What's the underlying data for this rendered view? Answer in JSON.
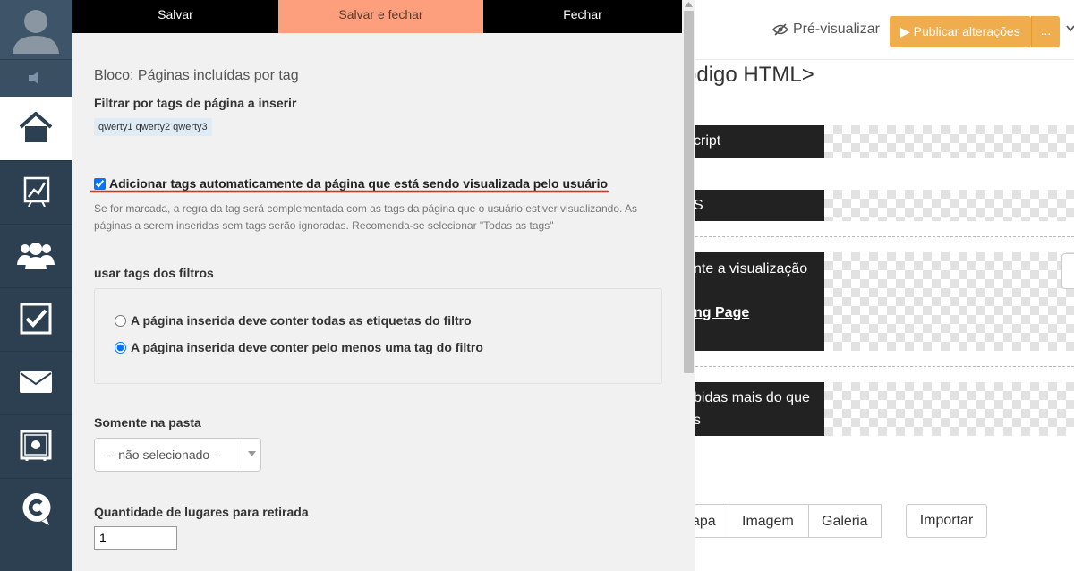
{
  "panel": {
    "tabs": [
      {
        "label": "Salvar"
      },
      {
        "label": "Salvar e fechar"
      },
      {
        "label": "Fechar"
      }
    ],
    "block_title": "Bloco: Páginas incluídas por tag",
    "filter_label": "Filtrar por tags de página a inserir",
    "tags_value": "qwerty1 qwerty2 qwerty3",
    "auto_tags": {
      "label": "Adicionar tags automaticamente da página que está sendo visualizada pelo usuário",
      "checked": true
    },
    "help_text": "Se for marcada, a regra da tag será complementada com as tags da página que o usuário estiver visualizando. As páginas a serem inseridas sem tags serão ignoradas. Recomenda-se selecionar \"Todas as tags\"",
    "filter_mode_label": "usar tags dos filtros",
    "radio_options": [
      {
        "label": "A página inserida deve conter todas as etiquetas do filtro",
        "selected": false
      },
      {
        "label": "A página inserida deve conter pelo menos uma tag do filtro",
        "selected": true
      }
    ],
    "folder_label": "Somente na pasta",
    "folder_select_value": "-- não selecionado --",
    "quantity_label": "Quantidade de lugares para retirada",
    "quantity_value": "1"
  },
  "sidebar": {
    "items": [
      {
        "icon": "home-icon",
        "active": true
      },
      {
        "icon": "chart-icon",
        "active": false
      },
      {
        "icon": "users-icon",
        "active": false
      },
      {
        "icon": "checkbox-icon",
        "active": false
      },
      {
        "icon": "mail-icon",
        "active": false
      },
      {
        "icon": "safe-icon",
        "active": false
      },
      {
        "icon": "logo-c-icon",
        "active": false
      }
    ]
  },
  "background_page": {
    "preview_label": "Pré-visualizar",
    "publish_label": "▶ Publicar alterações",
    "publish_more": "...",
    "heading": "ódigo HTML>",
    "blocks": [
      "cript",
      "S",
      "nte a visualização",
      "ng Page",
      "bidas mais do que",
      "s"
    ],
    "tabs": [
      "apa",
      "Imagem",
      "Galeria"
    ],
    "import_label": "Importar"
  },
  "colors": {
    "sidebar_bg": "#2c4052",
    "accent_tab": "#fd9e7c",
    "publish_button": "#f0ad4e",
    "underline_red": "#c0392b"
  }
}
